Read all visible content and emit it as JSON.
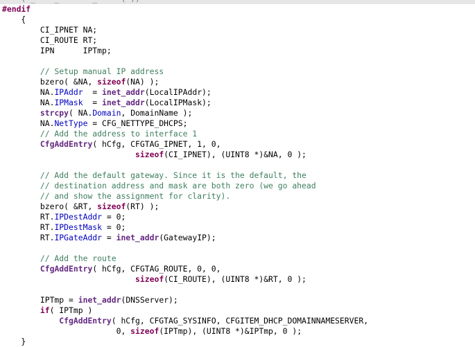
{
  "editor": {
    "language": "C",
    "colors": {
      "background": "#ffffff",
      "inactive_background": "#e6e6e6",
      "keyword": "#7f0055",
      "member": "#0000c0",
      "function": "#642880",
      "comment": "#3f7f5f"
    },
    "lines": [
      {
        "inactive": true,
        "tokens": [
          {
            "t": "    ( ",
            "c": "ghost"
          },
          {
            "t": "_    _       _     ( ))",
            "c": "ghost"
          }
        ]
      },
      {
        "inactive": false,
        "tokens": [
          {
            "t": "#endif",
            "c": "pre"
          }
        ]
      },
      {
        "inactive": false,
        "tokens": [
          {
            "t": "    {",
            "c": "plain"
          }
        ]
      },
      {
        "inactive": false,
        "tokens": [
          {
            "t": "        CI_IPNET NA;",
            "c": "plain"
          }
        ]
      },
      {
        "inactive": false,
        "tokens": [
          {
            "t": "        CI_ROUTE RT;",
            "c": "plain"
          }
        ]
      },
      {
        "inactive": false,
        "tokens": [
          {
            "t": "        IPN      IPTmp;",
            "c": "plain"
          }
        ]
      },
      {
        "inactive": false,
        "tokens": [
          {
            "t": "",
            "c": "plain"
          }
        ]
      },
      {
        "inactive": false,
        "tokens": [
          {
            "t": "        // Setup manual IP address",
            "c": "comment"
          }
        ]
      },
      {
        "inactive": false,
        "tokens": [
          {
            "t": "        bzero( &NA, ",
            "c": "plain"
          },
          {
            "t": "sizeof",
            "c": "kw"
          },
          {
            "t": "(NA) );",
            "c": "plain"
          }
        ]
      },
      {
        "inactive": false,
        "tokens": [
          {
            "t": "        NA.",
            "c": "plain"
          },
          {
            "t": "IPAddr",
            "c": "member"
          },
          {
            "t": "  = ",
            "c": "plain"
          },
          {
            "t": "inet_addr",
            "c": "func"
          },
          {
            "t": "(LocalIPAddr);",
            "c": "plain"
          }
        ]
      },
      {
        "inactive": false,
        "tokens": [
          {
            "t": "        NA.",
            "c": "plain"
          },
          {
            "t": "IPMask",
            "c": "member"
          },
          {
            "t": "  = ",
            "c": "plain"
          },
          {
            "t": "inet_addr",
            "c": "func"
          },
          {
            "t": "(LocalIPMask);",
            "c": "plain"
          }
        ]
      },
      {
        "inactive": false,
        "tokens": [
          {
            "t": "        ",
            "c": "plain"
          },
          {
            "t": "strcpy",
            "c": "func"
          },
          {
            "t": "( NA.",
            "c": "plain"
          },
          {
            "t": "Domain",
            "c": "member"
          },
          {
            "t": ", DomainName );",
            "c": "plain"
          }
        ]
      },
      {
        "inactive": false,
        "tokens": [
          {
            "t": "        NA.",
            "c": "plain"
          },
          {
            "t": "NetType",
            "c": "member"
          },
          {
            "t": " = CFG_NETTYPE_DHCPS;",
            "c": "plain"
          }
        ]
      },
      {
        "inactive": false,
        "tokens": [
          {
            "t": "        // Add the address to interface 1",
            "c": "comment"
          }
        ]
      },
      {
        "inactive": false,
        "tokens": [
          {
            "t": "        ",
            "c": "plain"
          },
          {
            "t": "CfgAddEntry",
            "c": "func"
          },
          {
            "t": "( hCfg, CFGTAG_IPNET, 1, 0,",
            "c": "plain"
          }
        ]
      },
      {
        "inactive": false,
        "tokens": [
          {
            "t": "                            ",
            "c": "plain"
          },
          {
            "t": "sizeof",
            "c": "kw"
          },
          {
            "t": "(CI_IPNET), (UINT8 *)&NA, 0 );",
            "c": "plain"
          }
        ]
      },
      {
        "inactive": false,
        "tokens": [
          {
            "t": "",
            "c": "plain"
          }
        ]
      },
      {
        "inactive": false,
        "tokens": [
          {
            "t": "        // Add the default gateway. Since it is the default, the",
            "c": "comment"
          }
        ]
      },
      {
        "inactive": false,
        "tokens": [
          {
            "t": "        // destination address and mask are both zero (we go ahead",
            "c": "comment"
          }
        ]
      },
      {
        "inactive": false,
        "tokens": [
          {
            "t": "        // and show the assignment for clarity).",
            "c": "comment"
          }
        ]
      },
      {
        "inactive": false,
        "tokens": [
          {
            "t": "        bzero( &RT, ",
            "c": "plain"
          },
          {
            "t": "sizeof",
            "c": "kw"
          },
          {
            "t": "(RT) );",
            "c": "plain"
          }
        ]
      },
      {
        "inactive": false,
        "tokens": [
          {
            "t": "        RT.",
            "c": "plain"
          },
          {
            "t": "IPDestAddr",
            "c": "member"
          },
          {
            "t": " = 0;",
            "c": "plain"
          }
        ]
      },
      {
        "inactive": false,
        "tokens": [
          {
            "t": "        RT.",
            "c": "plain"
          },
          {
            "t": "IPDestMask",
            "c": "member"
          },
          {
            "t": " = 0;",
            "c": "plain"
          }
        ]
      },
      {
        "inactive": false,
        "tokens": [
          {
            "t": "        RT.",
            "c": "plain"
          },
          {
            "t": "IPGateAddr",
            "c": "member"
          },
          {
            "t": " = ",
            "c": "plain"
          },
          {
            "t": "inet_addr",
            "c": "func"
          },
          {
            "t": "(GatewayIP);",
            "c": "plain"
          }
        ]
      },
      {
        "inactive": false,
        "tokens": [
          {
            "t": "",
            "c": "plain"
          }
        ]
      },
      {
        "inactive": false,
        "tokens": [
          {
            "t": "        // Add the route",
            "c": "comment"
          }
        ]
      },
      {
        "inactive": false,
        "tokens": [
          {
            "t": "        ",
            "c": "plain"
          },
          {
            "t": "CfgAddEntry",
            "c": "func"
          },
          {
            "t": "( hCfg, CFGTAG_ROUTE, 0, 0,",
            "c": "plain"
          }
        ]
      },
      {
        "inactive": false,
        "tokens": [
          {
            "t": "                            ",
            "c": "plain"
          },
          {
            "t": "sizeof",
            "c": "kw"
          },
          {
            "t": "(CI_ROUTE), (UINT8 *)&RT, 0 );",
            "c": "plain"
          }
        ]
      },
      {
        "inactive": false,
        "tokens": [
          {
            "t": "",
            "c": "plain"
          }
        ]
      },
      {
        "inactive": false,
        "tokens": [
          {
            "t": "        IPTmp = ",
            "c": "plain"
          },
          {
            "t": "inet_addr",
            "c": "func"
          },
          {
            "t": "(DNSServer);",
            "c": "plain"
          }
        ]
      },
      {
        "inactive": false,
        "tokens": [
          {
            "t": "        ",
            "c": "plain"
          },
          {
            "t": "if",
            "c": "kw"
          },
          {
            "t": "( IPTmp )",
            "c": "plain"
          }
        ]
      },
      {
        "inactive": false,
        "tokens": [
          {
            "t": "            ",
            "c": "plain"
          },
          {
            "t": "CfgAddEntry",
            "c": "func"
          },
          {
            "t": "( hCfg, CFGTAG_SYSINFO, CFGITEM_DHCP_DOMAINNAMESERVER,",
            "c": "plain"
          }
        ]
      },
      {
        "inactive": false,
        "tokens": [
          {
            "t": "                        0, ",
            "c": "plain"
          },
          {
            "t": "sizeof",
            "c": "kw"
          },
          {
            "t": "(IPTmp), (UINT8 *)&IPTmp, 0 );",
            "c": "plain"
          }
        ]
      },
      {
        "inactive": false,
        "tokens": [
          {
            "t": "    }",
            "c": "plain"
          }
        ]
      }
    ]
  }
}
